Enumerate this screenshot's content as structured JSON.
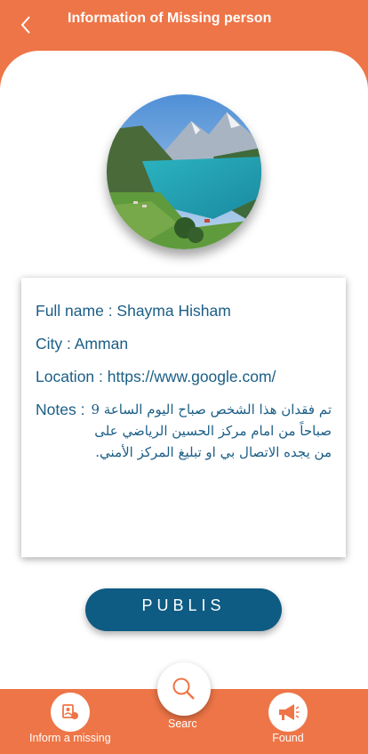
{
  "header": {
    "title": "Information of Missing person"
  },
  "profile": {
    "full_name": "Full name : Shayma Hisham",
    "city": "City : Amman",
    "location": "Location : https://www.google.com/",
    "notes_label": "Notes :",
    "notes_text": "تم فقدان هذا الشخص صباح اليوم الساعة 9 صباحاً من امام مركز الحسين الرياضي على من يجده الاتصال بي او تبليغ المركز الأمني."
  },
  "publish_label": "PUBLIS",
  "nav": {
    "inform_label": "Inform a missing",
    "search_label": "Searc",
    "found_label": "Found"
  },
  "colors": {
    "accent": "#ee7547",
    "primary": "#0e5b83",
    "text": "#1b5e86"
  },
  "icons": {
    "back": "chevron-left-icon",
    "inform": "report-person-icon",
    "search": "search-icon",
    "found": "megaphone-icon"
  }
}
